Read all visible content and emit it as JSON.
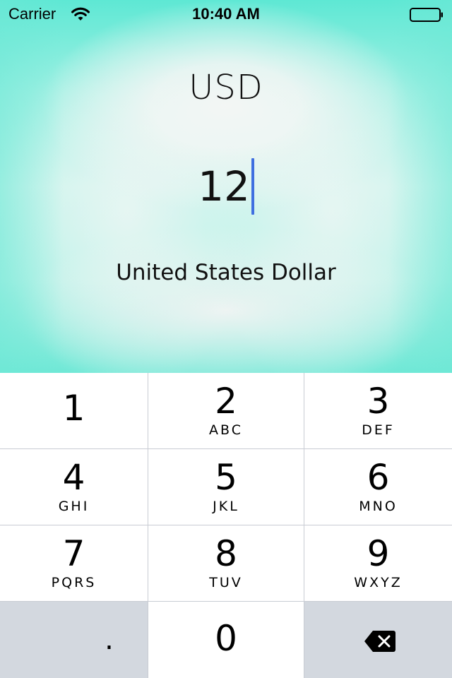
{
  "status_bar": {
    "carrier": "Carrier",
    "time": "10:40 AM",
    "wifi_icon": "wifi-icon",
    "battery_icon": "battery-icon"
  },
  "converter": {
    "currency_code": "USD",
    "amount": "12",
    "currency_name": "United States Dollar",
    "caret_color": "#3f6fe0"
  },
  "keypad": {
    "keys": [
      {
        "digit": "1",
        "letters": ""
      },
      {
        "digit": "2",
        "letters": "ABC"
      },
      {
        "digit": "3",
        "letters": "DEF"
      },
      {
        "digit": "4",
        "letters": "GHI"
      },
      {
        "digit": "5",
        "letters": "JKL"
      },
      {
        "digit": "6",
        "letters": "MNO"
      },
      {
        "digit": "7",
        "letters": "PQRS"
      },
      {
        "digit": "8",
        "letters": "TUV"
      },
      {
        "digit": "9",
        "letters": "WXYZ"
      }
    ],
    "decimal": ".",
    "zero": "0",
    "delete_icon": "backspace-icon"
  }
}
